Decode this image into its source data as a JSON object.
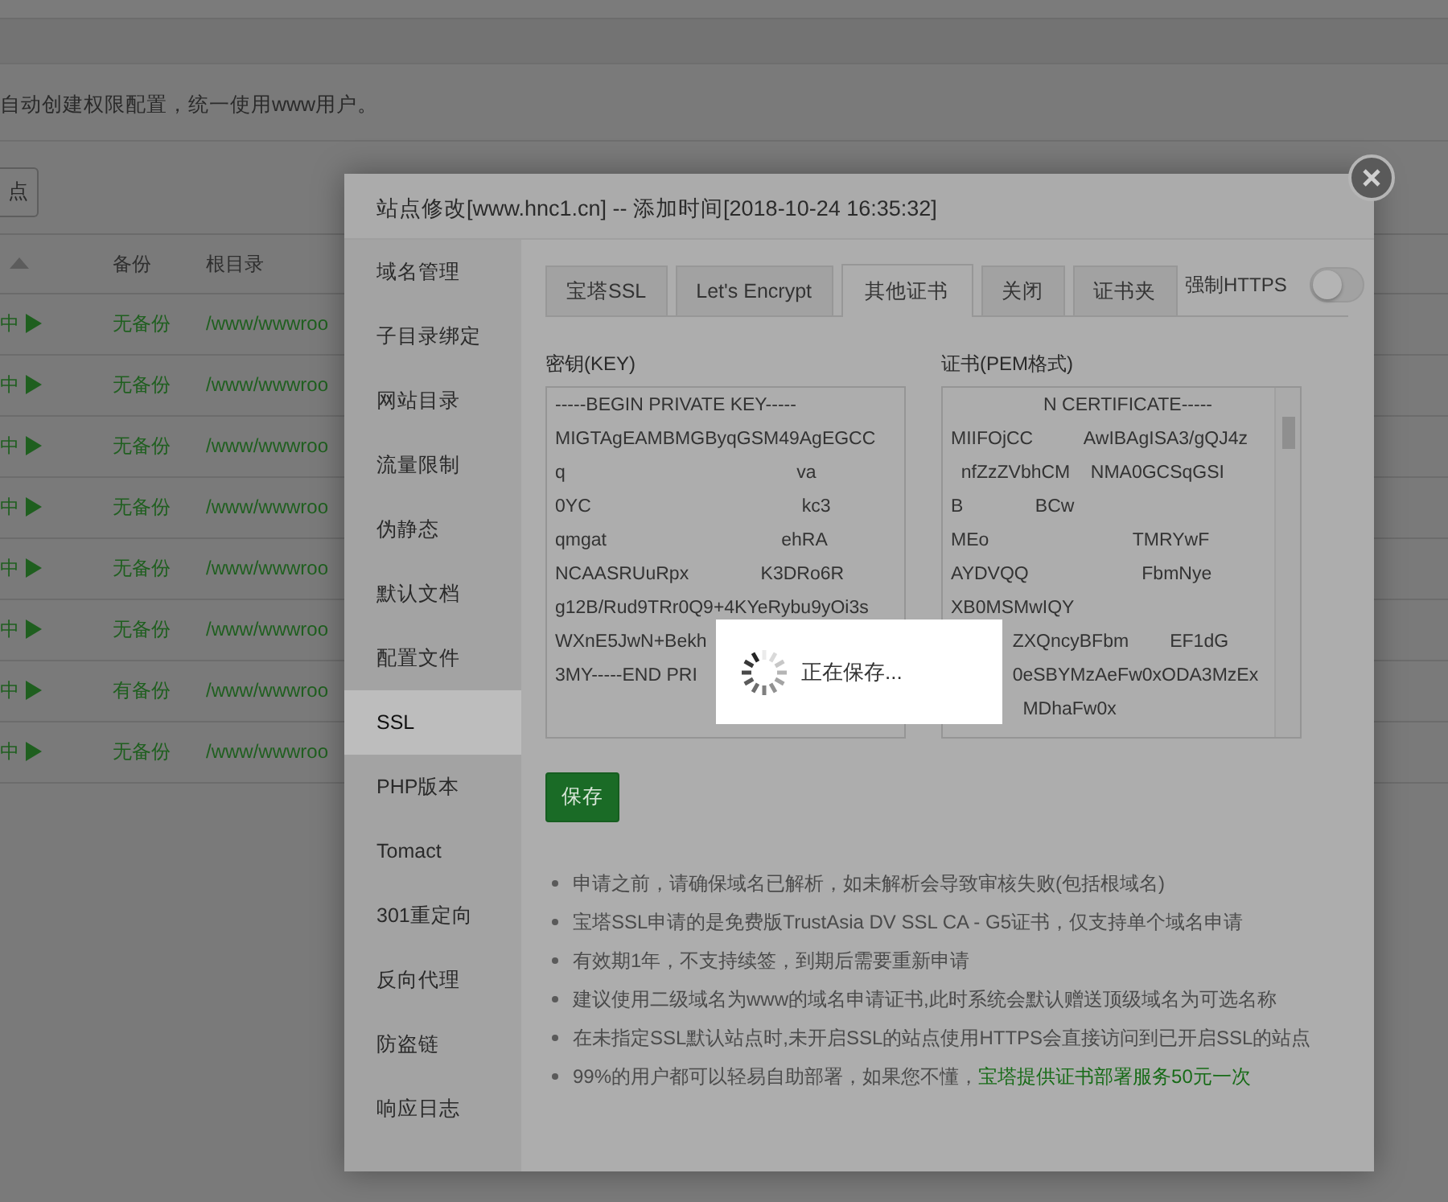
{
  "background": {
    "notice": "自动创建权限配置，统一使用www用户。",
    "button": "点",
    "table": {
      "columns": [
        "备份",
        "根目录"
      ],
      "rows": [
        {
          "status": "中",
          "backup": "无备份",
          "path": "/www/wwwroo"
        },
        {
          "status": "中",
          "backup": "无备份",
          "path": "/www/wwwroo"
        },
        {
          "status": "中",
          "backup": "无备份",
          "path": "/www/wwwroo"
        },
        {
          "status": "中",
          "backup": "无备份",
          "path": "/www/wwwroo"
        },
        {
          "status": "中",
          "backup": "无备份",
          "path": "/www/wwwroo"
        },
        {
          "status": "中",
          "backup": "无备份",
          "path": "/www/wwwroo"
        },
        {
          "status": "中",
          "backup": "有备份",
          "path": "/www/wwwroo"
        },
        {
          "status": "中",
          "backup": "无备份",
          "path": "/www/wwwroo"
        }
      ]
    }
  },
  "modal": {
    "title": "站点修改[www.hnc1.cn] -- 添加时间[2018-10-24 16:35:32]",
    "menu": [
      {
        "label": "域名管理",
        "selected": false
      },
      {
        "label": "子目录绑定",
        "selected": false
      },
      {
        "label": "网站目录",
        "selected": false
      },
      {
        "label": "流量限制",
        "selected": false
      },
      {
        "label": "伪静态",
        "selected": false
      },
      {
        "label": "默认文档",
        "selected": false
      },
      {
        "label": "配置文件",
        "selected": false
      },
      {
        "label": "SSL",
        "selected": true
      },
      {
        "label": "PHP版本",
        "selected": false
      },
      {
        "label": "Tomact",
        "selected": false
      },
      {
        "label": "301重定向",
        "selected": false
      },
      {
        "label": "反向代理",
        "selected": false
      },
      {
        "label": "防盗链",
        "selected": false
      },
      {
        "label": "响应日志",
        "selected": false
      }
    ],
    "tabs": [
      {
        "label": "宝塔SSL",
        "selected": false
      },
      {
        "label": "Let's Encrypt",
        "selected": false
      },
      {
        "label": "其他证书",
        "selected": true
      },
      {
        "label": "关闭",
        "selected": false
      },
      {
        "label": "证书夹",
        "selected": false
      }
    ],
    "force_https": {
      "label": "强制HTTPS",
      "on": false
    },
    "key": {
      "label": "密钥(KEY)",
      "lines": [
        "-----BEGIN PRIVATE KEY-----",
        "MIGTAgEAMBMGByqGSM49AgEGCC",
        "q                                             va",
        "0YC                                         kc3",
        "qmgat                                  ehRA",
        "NCAASRUuRpx              K3DRo6R",
        "g12B/Rud9TRr0Q9+4KYeRybu9yOi3s",
        "WXnE5JwN+Bekh",
        "3MY-----END PRI"
      ]
    },
    "cert": {
      "label": "证书(PEM格式)",
      "lines": [
        "                  N CERTIFICATE-----",
        "MIIFOjCC          AwIBAgISA3/gQJ4z",
        "  nfZzZVbhCM    NMA0GCSqGSI",
        "B              BCw",
        "MEo                            TMRYwF",
        "AYDVQQ                      FbmNye",
        "XB0MSMwIQY",
        "            ZXQncyBFbm        EF1dG",
        "            0eSBYMzAeFw0xODA3MzEx",
        "              MDhaFw0x"
      ]
    },
    "save": "保存",
    "notes": [
      {
        "text": "申请之前，请确保域名已解析，如未解析会导致审核失败(包括根域名)"
      },
      {
        "text": "宝塔SSL申请的是免费版TrustAsia DV SSL CA - G5证书，仅支持单个域名申请"
      },
      {
        "text": "有效期1年，不支持续签，到期后需要重新申请"
      },
      {
        "text": "建议使用二级域名为www的域名申请证书,此时系统会默认赠送顶级域名为可选名称"
      },
      {
        "text": "在未指定SSL默认站点时,未开启SSL的站点使用HTTPS会直接访问到已开启SSL的站点"
      },
      {
        "text": "99%的用户都可以轻易自助部署，如果您不懂，",
        "link": "宝塔提供证书部署服务50元一次"
      }
    ],
    "loading": {
      "text": "正在保存..."
    }
  }
}
